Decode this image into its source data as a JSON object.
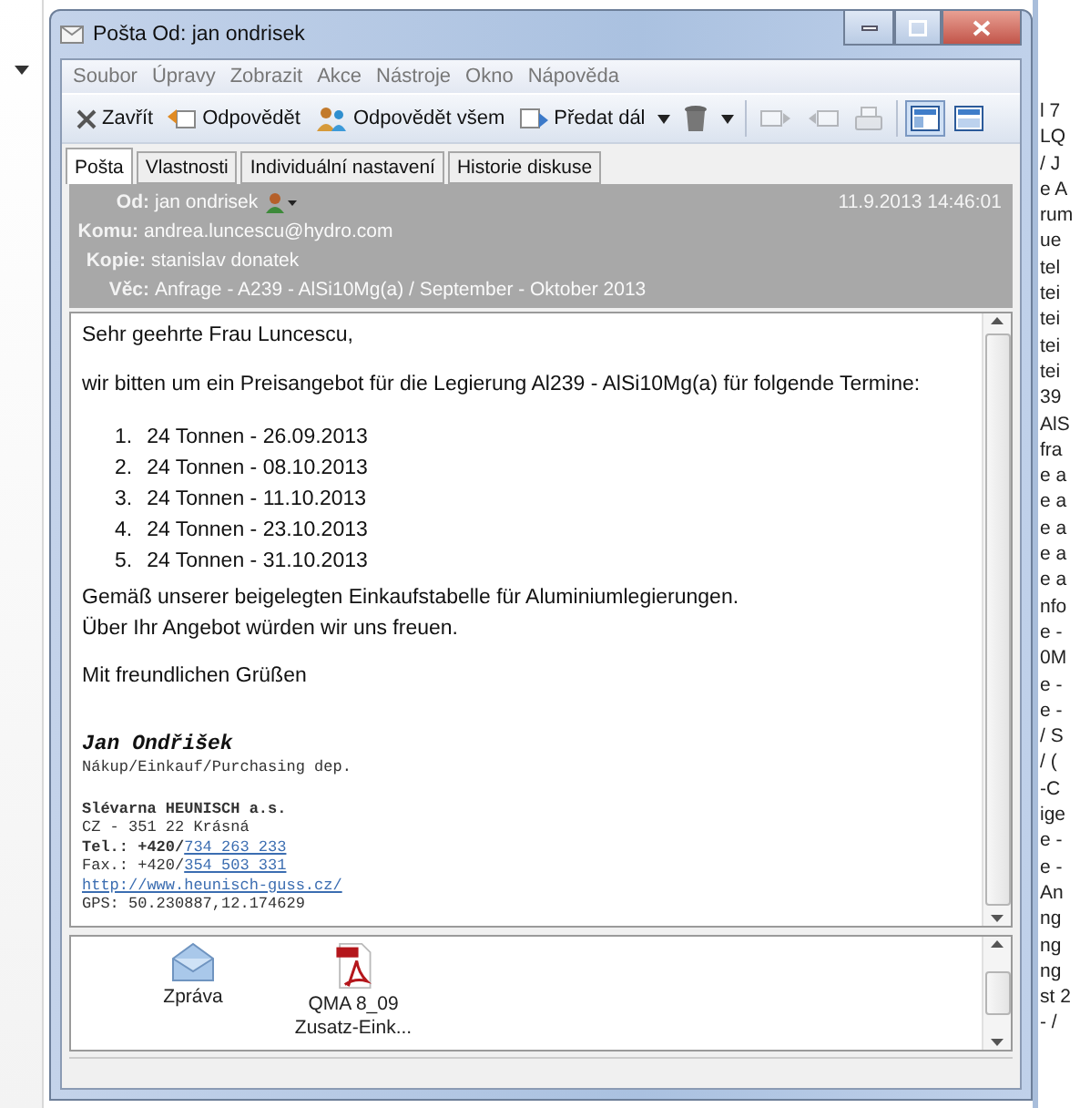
{
  "window": {
    "title": "Pošta Od: jan ondrisek"
  },
  "menu": [
    "Soubor",
    "Úpravy",
    "Zobrazit",
    "Akce",
    "Nástroje",
    "Okno",
    "Nápověda"
  ],
  "toolbar": [
    {
      "kind": "button",
      "label": "Zavřít"
    },
    {
      "kind": "button",
      "label": "Odpovědět"
    },
    {
      "kind": "button",
      "label": "Odpovědět všem"
    },
    {
      "kind": "button",
      "label": "Předat dál",
      "dropdown": true
    },
    {
      "kind": "icon",
      "dropdown": true,
      "disabled": false,
      "selected": false
    },
    {
      "kind": "icon",
      "disabled": true,
      "selected": false
    },
    {
      "kind": "icon",
      "disabled": true,
      "selected": false
    },
    {
      "kind": "icon",
      "disabled": true,
      "selected": false
    },
    {
      "kind": "icon",
      "disabled": false,
      "selected": true
    },
    {
      "kind": "icon",
      "disabled": false,
      "selected": false
    }
  ],
  "tabs": [
    {
      "label": "Pošta",
      "selected": true
    },
    {
      "label": "Vlastnosti",
      "selected": false
    },
    {
      "label": "Individuální nastavení",
      "selected": false
    },
    {
      "label": "Historie diskuse",
      "selected": false
    }
  ],
  "header": {
    "date": "11.9.2013 14:46:01",
    "fields": [
      {
        "label": "Od:",
        "value": "jan ondrisek",
        "contact_icon": true
      },
      {
        "label": "Komu:",
        "value": "andrea.luncescu@hydro.com"
      },
      {
        "label": "Kopie:",
        "value": "stanislav donatek"
      },
      {
        "label": "Věc:",
        "value": "Anfrage - A239 - AlSi10Mg(a) / September - Oktober 2013"
      }
    ]
  },
  "body": {
    "greeting": "Sehr geehrte Frau Luncescu,",
    "intro": "wir bitten um ein Preisangebot für die Legierung Al239 - AlSi10Mg(a) für folgende Termine:",
    "list": [
      {
        "marker": "1.",
        "text": "24 Tonnen - 26.09.2013"
      },
      {
        "marker": "2.",
        "text": "24 Tonnen - 08.10.2013"
      },
      {
        "marker": "3.",
        "text": "24 Tonnen - 11.10.2013"
      },
      {
        "marker": "4.",
        "text": "24 Tonnen - 23.10.2013"
      },
      {
        "marker": "5.",
        "text": "24 Tonnen - 31.10.2013"
      }
    ],
    "paragraph": [
      "Gemäß unserer beigelegten Einkaufstabelle für Aluminiumlegierungen.",
      "Über Ihr Angebot würden wir uns freuen."
    ],
    "closing": "Mit freundlichen Grüßen",
    "signature": [
      {
        "kind": "name",
        "text": "Jan Ondřišek"
      },
      {
        "kind": "line",
        "text": "Nákup/Einkauf/Purchasing dep.",
        "bold": false
      },
      {
        "kind": "company",
        "text": "Slévarna HEUNISCH a.s."
      },
      {
        "kind": "line",
        "text": "CZ - 351 22 Krásná",
        "bold": false
      },
      {
        "kind": "phone",
        "text": "Tel.: +420/",
        "link": "734 263 233",
        "bold": true
      },
      {
        "kind": "phone",
        "text": "Fax.: +420/",
        "link": "354 503 331",
        "bold": false
      },
      {
        "kind": "url",
        "link": "http://www.heunisch-guss.cz/"
      },
      {
        "kind": "line",
        "text": "GPS: 50.230887,12.174629",
        "bold": false
      }
    ]
  },
  "attachments": [
    {
      "kind": "message",
      "label": "Zpráva"
    },
    {
      "kind": "pdf",
      "label": "QMA 8_09 Zusatz-Eink..."
    }
  ],
  "background_window": {
    "fragments": [
      {
        "text": "l 7"
      },
      {
        "text": "LQ"
      },
      {
        "text": "/ J"
      },
      {
        "text": "e A"
      },
      {
        "text": "rum"
      },
      {
        "text": "ue"
      },
      {
        "text": "tel"
      },
      {
        "text": "tei"
      },
      {
        "text": "tei"
      },
      {
        "text": "tei"
      },
      {
        "text": "tei"
      },
      {
        "text": "39"
      },
      {
        "text": "AlS"
      },
      {
        "text": "fra"
      },
      {
        "text": "e a"
      },
      {
        "text": "e a"
      },
      {
        "text": "e a"
      },
      {
        "text": "e a"
      },
      {
        "text": "e a"
      },
      {
        "text": "nfo"
      },
      {
        "text": "e -"
      },
      {
        "text": "0M"
      },
      {
        "text": "e -"
      },
      {
        "text": "e -"
      },
      {
        "text": "/ S"
      },
      {
        "text": "/ ("
      },
      {
        "text": "-C"
      },
      {
        "text": "ige"
      },
      {
        "text": "e -"
      },
      {
        "text": "e -"
      },
      {
        "text": "An"
      },
      {
        "text": "ng"
      },
      {
        "text": "ng"
      },
      {
        "text": "ng"
      },
      {
        "text": "st 2"
      },
      {
        "text": "- /"
      }
    ]
  }
}
